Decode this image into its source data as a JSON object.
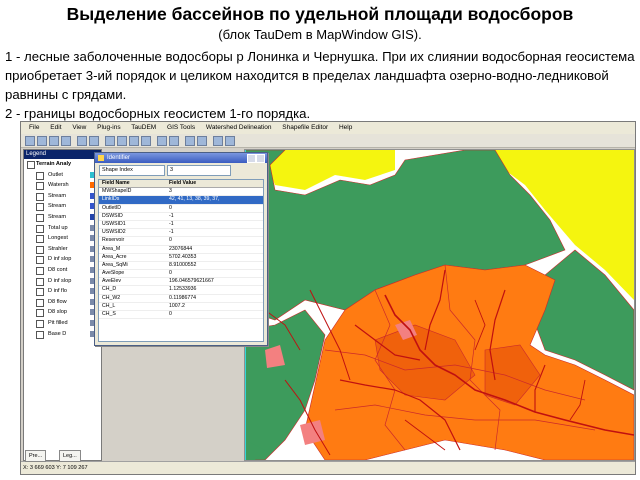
{
  "slide": {
    "title": "Выделение бассейнов по удельной площади водосборов",
    "subtitle": "(блок TauDem в MapWindow GIS).",
    "paragraphs": [
      "1 - лесные заболоченные водосборы р Лонинка и Чернушка. При их слиянии водосборная геосистема приобретает 3-ий порядок и целиком находится в пределах ландшафта озерно-водно-ледниковой равнины с грядами.",
      "2 - границы водосборных геосистем 1-го порядка."
    ]
  },
  "app": {
    "menu": [
      "File",
      "Edit",
      "View",
      "Plug-ins",
      "TauDEM",
      "GIS Tools",
      "Watershed Delineation",
      "Shapefile Editor",
      "Help"
    ],
    "legend": {
      "caption": "Legend",
      "group": "Terrain Analy",
      "layers": [
        {
          "label": "Outlet",
          "swatch": "#2bbfcf"
        },
        {
          "label": "Watersh",
          "swatch": "#ff6a00"
        },
        {
          "label": "Stream",
          "swatch": "#3355cc"
        },
        {
          "label": "Stream",
          "swatch": "#3355cc"
        },
        {
          "label": "Stream",
          "swatch": "#2244aa"
        },
        {
          "label": "Total up",
          "swatch": "#7a8aa8"
        },
        {
          "label": "Longest",
          "swatch": "#7a8aa8"
        },
        {
          "label": "Strahler",
          "swatch": "#7a8aa8"
        },
        {
          "label": "D inf slop",
          "swatch": "#7a8aa8"
        },
        {
          "label": "D8 cont",
          "swatch": "#7a8aa8"
        },
        {
          "label": "D inf slop",
          "swatch": "#7a8aa8"
        },
        {
          "label": "D inf flo",
          "swatch": "#7a8aa8"
        },
        {
          "label": "D8 flow",
          "swatch": "#7a8aa8"
        },
        {
          "label": "D8 slop",
          "swatch": "#7a8aa8"
        },
        {
          "label": "Pit filled",
          "swatch": "#7a8aa8"
        },
        {
          "label": "Base D",
          "swatch": "#7a8aa8"
        }
      ]
    },
    "status": {
      "coords": "X: 3 669 603 Y: 7 109 267",
      "tabs": [
        "Pre...",
        "Leg..."
      ]
    },
    "identifier": {
      "title": "Identifier",
      "select_left": "Shape Index",
      "select_right": "3",
      "header": {
        "field": "Field Name",
        "value": "Field Value"
      },
      "rows": [
        {
          "field": "MWShapeID",
          "value": "3"
        },
        {
          "field": "LinkIDs",
          "value": "42, 41, 13, 38, 39, 37,"
        },
        {
          "field": "OutletID",
          "value": "0"
        },
        {
          "field": "DSWSID",
          "value": "-1"
        },
        {
          "field": "USWSID1",
          "value": "-1"
        },
        {
          "field": "USWSID2",
          "value": "-1"
        },
        {
          "field": "Reservoir",
          "value": "0"
        },
        {
          "field": "Area_M",
          "value": "23076844"
        },
        {
          "field": "Area_Acre",
          "value": "5702.40353"
        },
        {
          "field": "Area_SqMi",
          "value": "8.91000552"
        },
        {
          "field": "AveSlope",
          "value": "0"
        },
        {
          "field": "AveElev",
          "value": "196.046579621667"
        },
        {
          "field": "CH_D",
          "value": "1.12533936"
        },
        {
          "field": "CH_W2",
          "value": "0.11986774"
        },
        {
          "field": "CH_L",
          "value": "1007.2"
        },
        {
          "field": "CH_S",
          "value": "0"
        }
      ]
    },
    "map_colors": {
      "background": "#ffffff",
      "yellow": "#f5f50f",
      "green": "#3d9b5c",
      "orange": "#ff7b12",
      "dark_orange": "#f0610c",
      "pink": "#f38080",
      "streams": "#c01010",
      "boundaries": "#cc2a2a",
      "cyan": "#37d4d9"
    }
  }
}
